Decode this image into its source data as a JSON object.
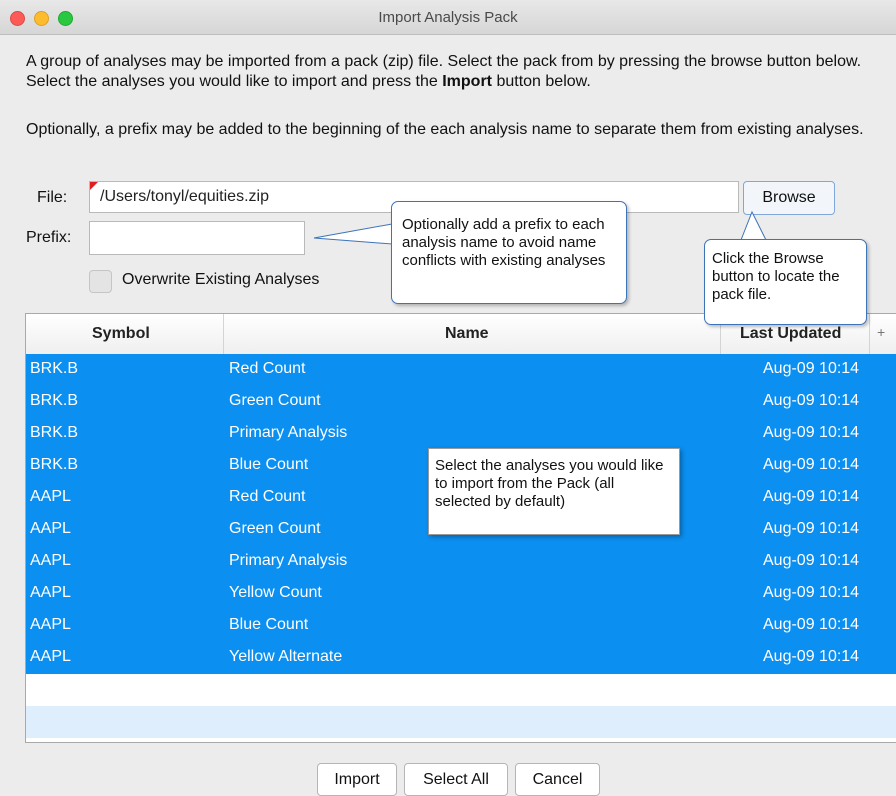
{
  "window": {
    "title": "Import Analysis Pack"
  },
  "description": {
    "para1_before": "A group of analyses may be imported from a pack (zip) file.  Select the pack from by pressing the browse button below.  Select the analyses you would like to import and press the ",
    "para1_bold": "Import",
    "para1_after": " button below.",
    "para2": "Optionally, a prefix may be added to the beginning of the each analysis name to separate them from existing analyses."
  },
  "form": {
    "file_label": "File:",
    "file_value": "/Users/tonyl/equities.zip",
    "browse_label": "Browse",
    "prefix_label": "Prefix:",
    "prefix_value": "",
    "overwrite_label": "Overwrite Existing Analyses",
    "overwrite_checked": false
  },
  "callouts": {
    "prefix": "Optionally add a prefix to each analysis name to avoid name conflicts with existing analyses",
    "browse": "Click the Browse button to locate the pack file.",
    "table": "Select the analyses you would like to import from the Pack (all selected by default)"
  },
  "table": {
    "headers": {
      "symbol": "Symbol",
      "name": "Name",
      "last_updated": "Last Updated",
      "add": "+"
    },
    "rows": [
      {
        "symbol": "BRK.B",
        "name": "Red Count",
        "date": "Aug-09 10:14"
      },
      {
        "symbol": "BRK.B",
        "name": "Green Count",
        "date": "Aug-09 10:14"
      },
      {
        "symbol": "BRK.B",
        "name": "Primary Analysis",
        "date": "Aug-09 10:14"
      },
      {
        "symbol": "BRK.B",
        "name": "Blue Count",
        "date": "Aug-09 10:14"
      },
      {
        "symbol": "AAPL",
        "name": "Red Count",
        "date": "Aug-09 10:14"
      },
      {
        "symbol": "AAPL",
        "name": "Green Count",
        "date": "Aug-09 10:14"
      },
      {
        "symbol": "AAPL",
        "name": "Primary Analysis",
        "date": "Aug-09 10:14"
      },
      {
        "symbol": "AAPL",
        "name": "Yellow Count",
        "date": "Aug-09 10:14"
      },
      {
        "symbol": "AAPL",
        "name": "Blue Count",
        "date": "Aug-09 10:14"
      },
      {
        "symbol": "AAPL",
        "name": "Yellow Alternate",
        "date": "Aug-09 10:14"
      }
    ]
  },
  "buttons": {
    "import": "Import",
    "select_all": "Select All",
    "cancel": "Cancel"
  },
  "colors": {
    "selection": "#0b8ff0",
    "callout_border": "#3d73b9",
    "alt_row": "#dfeefc"
  }
}
